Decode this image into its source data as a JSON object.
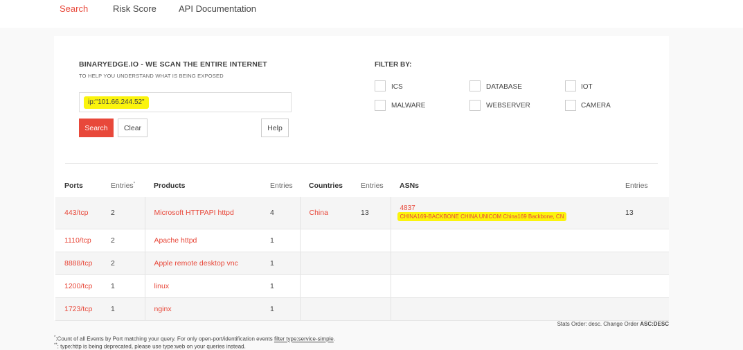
{
  "nav": {
    "search": "Search",
    "risk_score": "Risk Score",
    "api_docs": "API Documentation"
  },
  "hero": {
    "headline": "BINARYEDGE.IO - WE SCAN THE ENTIRE INTERNET",
    "subline": "TO HELP YOU UNDERSTAND WHAT IS BEING EXPOSED"
  },
  "search": {
    "query": "ip:\"101.66.244.52\"",
    "search_label": "Search",
    "clear_label": "Clear",
    "help_label": "Help"
  },
  "filter": {
    "title": "FILTER BY:",
    "options": [
      "ICS",
      "DATABASE",
      "IOT",
      "MALWARE",
      "WEBSERVER",
      "CAMERA"
    ]
  },
  "table": {
    "headers": {
      "ports": "Ports",
      "entries": "Entries",
      "products": "Products",
      "countries": "Countries",
      "asns": "ASNs",
      "asterisk": "*"
    },
    "rows": [
      {
        "port": "443/tcp",
        "port_entries": "2",
        "product": "Microsoft HTTPAPI httpd",
        "product_entries": "4",
        "country": "China",
        "country_entries": "13",
        "asn": "4837",
        "asn_desc": "CHINA169-BACKBONE CHINA UNICOM China169 Backbone, CN",
        "asn_entries": "13"
      },
      {
        "port": "1110/tcp",
        "port_entries": "2",
        "product": "Apache httpd",
        "product_entries": "1"
      },
      {
        "port": "8888/tcp",
        "port_entries": "2",
        "product": "Apple remote desktop vnc",
        "product_entries": "1"
      },
      {
        "port": "1200/tcp",
        "port_entries": "1",
        "product": "linux",
        "product_entries": "1"
      },
      {
        "port": "1723/tcp",
        "port_entries": "1",
        "product": "nginx",
        "product_entries": "1"
      }
    ]
  },
  "order": {
    "text": "Stats Order: desc. Change Order",
    "asc": "ASC",
    "sep": ":",
    "desc": "DESC"
  },
  "footnotes": {
    "note1_mark": "*",
    "note1_text": ":Count of all Events by Port matching your query. For only open-port/identification events",
    "note1_link": "filter type:service-simple",
    "note1_end": ".",
    "note2_mark": "**",
    "note2_text": ": type:http is being deprecated, please use type:web on your queries instead."
  }
}
